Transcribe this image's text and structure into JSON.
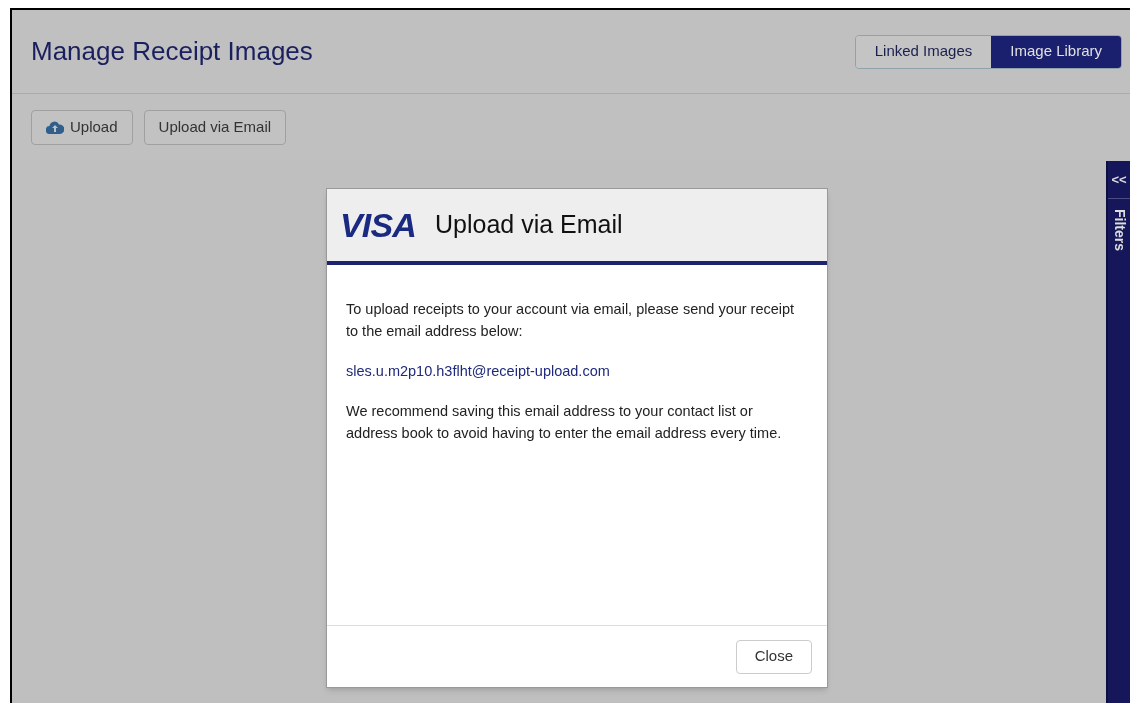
{
  "page": {
    "title": "Manage Receipt Images"
  },
  "view_tabs": [
    {
      "label": "Linked Images",
      "selected": false
    },
    {
      "label": "Image Library",
      "selected": true
    }
  ],
  "toolbar": [
    {
      "label": "Upload",
      "kind": "upload"
    },
    {
      "label": "Upload via Email",
      "kind": "plain"
    }
  ],
  "filters_panel": {
    "toggle": "<<",
    "label": "Filters"
  },
  "dialog": {
    "logo": "VISA",
    "title": "Upload via Email",
    "intro": "To upload receipts to your account via email, please send your receipt to the email address below:",
    "email": "sles.u.m2p10.h3flht@receipt-upload.com",
    "advice": "We recommend saving this email address to your contact list or address book to avoid having to enter the email address every time.",
    "close": "Close"
  }
}
